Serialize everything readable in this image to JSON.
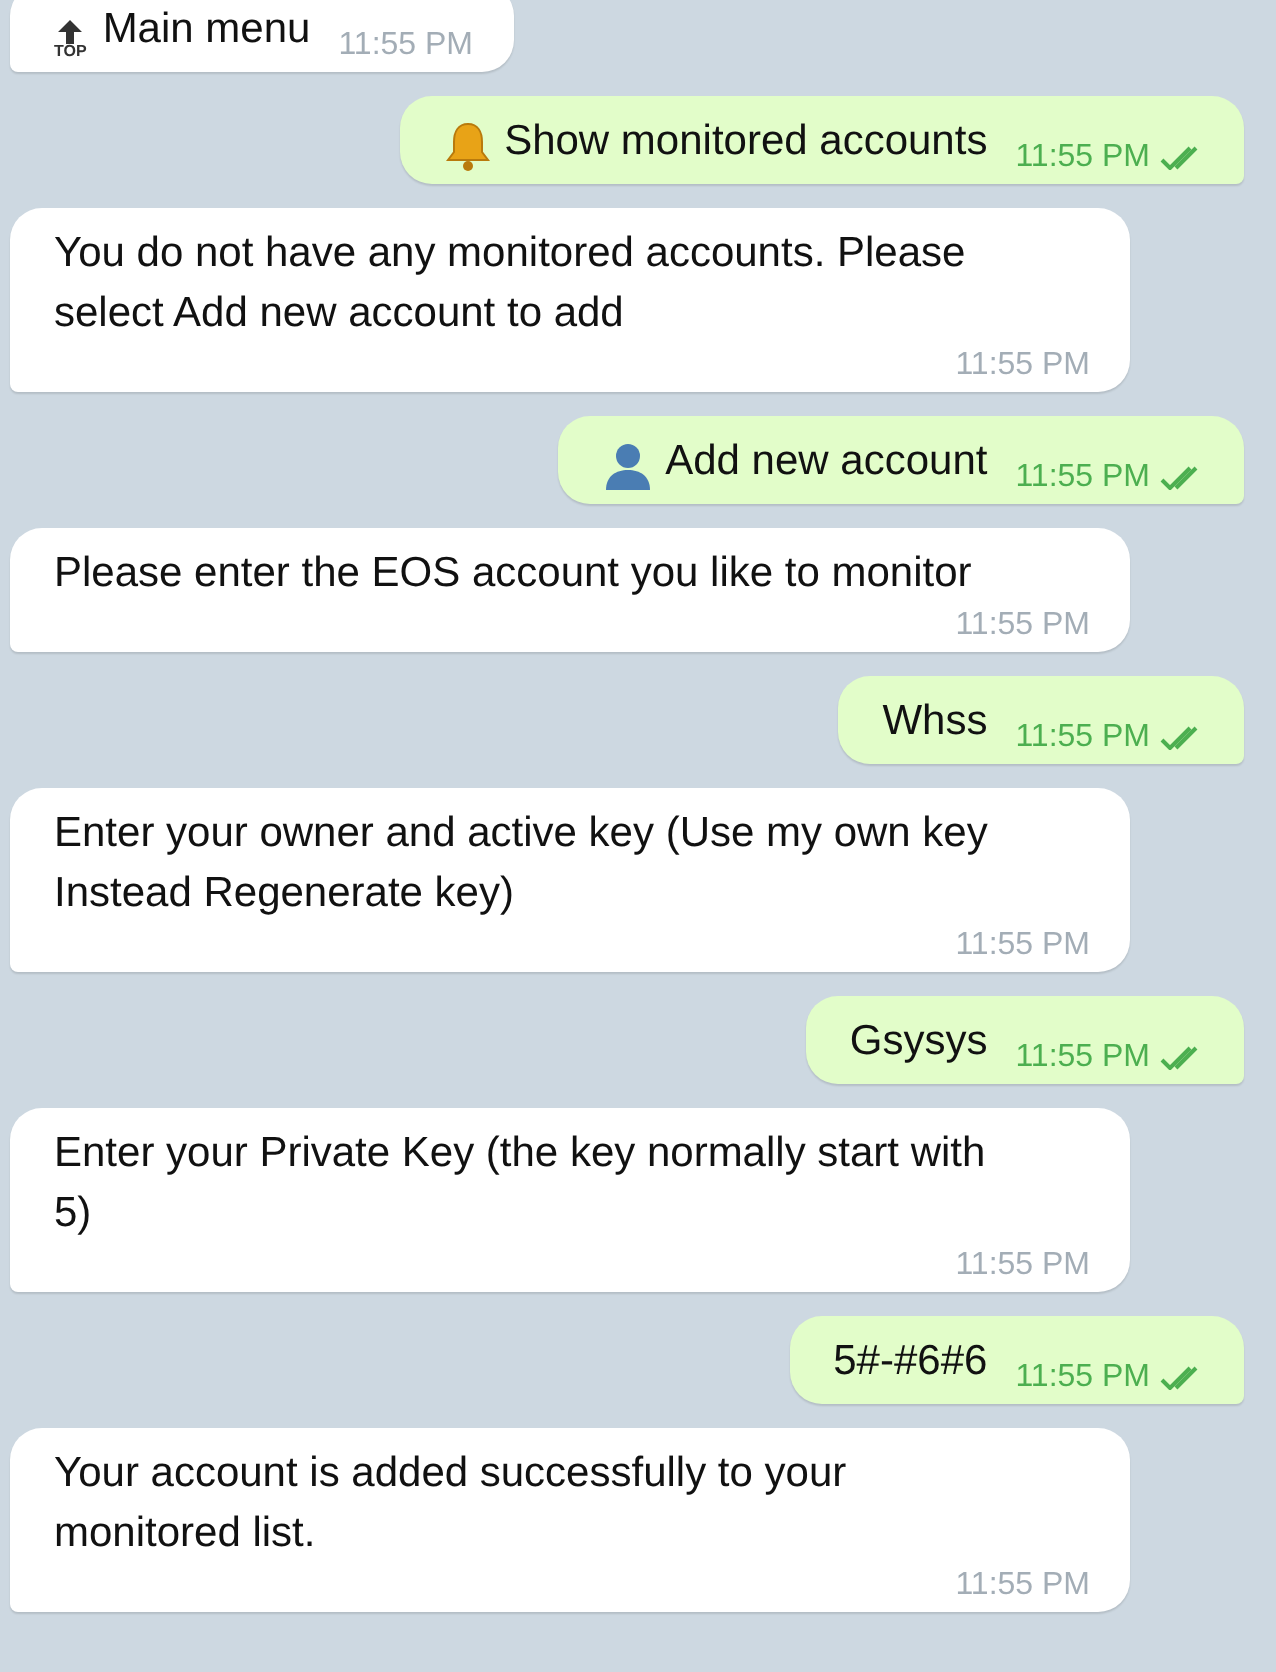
{
  "messages": [
    {
      "kind": "incoming",
      "icon": {
        "kind": "top",
        "label": "TOP"
      },
      "text": "Main menu",
      "time": "11:55 PM"
    },
    {
      "kind": "outgoing",
      "icon": {
        "kind": "bell"
      },
      "text": "Show monitored accounts",
      "time": "11:55 PM",
      "read": true
    },
    {
      "kind": "incoming",
      "text": "You do not have any monitored accounts. Please select Add new account to add",
      "time": "11:55 PM"
    },
    {
      "kind": "outgoing",
      "icon": {
        "kind": "person"
      },
      "text": "Add new account",
      "time": "11:55 PM",
      "read": true
    },
    {
      "kind": "incoming",
      "text": "Please enter the EOS account you like to monitor",
      "time": "11:55 PM"
    },
    {
      "kind": "outgoing",
      "text": "Whss",
      "time": "11:55 PM",
      "read": true
    },
    {
      "kind": "incoming",
      "text": "Enter your owner and active key (Use my own key Instead Regenerate key)",
      "time": "11:55 PM"
    },
    {
      "kind": "outgoing",
      "text": "Gsysys",
      "time": "11:55 PM",
      "read": true
    },
    {
      "kind": "incoming",
      "text": "Enter your Private Key (the key normally start with 5)",
      "time": "11:55 PM"
    },
    {
      "kind": "outgoing",
      "text": "5#-#6#6",
      "time": "11:55 PM",
      "read": true
    },
    {
      "kind": "incoming",
      "text": "Your account is added successfully to your monitored list.",
      "time": "11:55 PM"
    }
  ]
}
